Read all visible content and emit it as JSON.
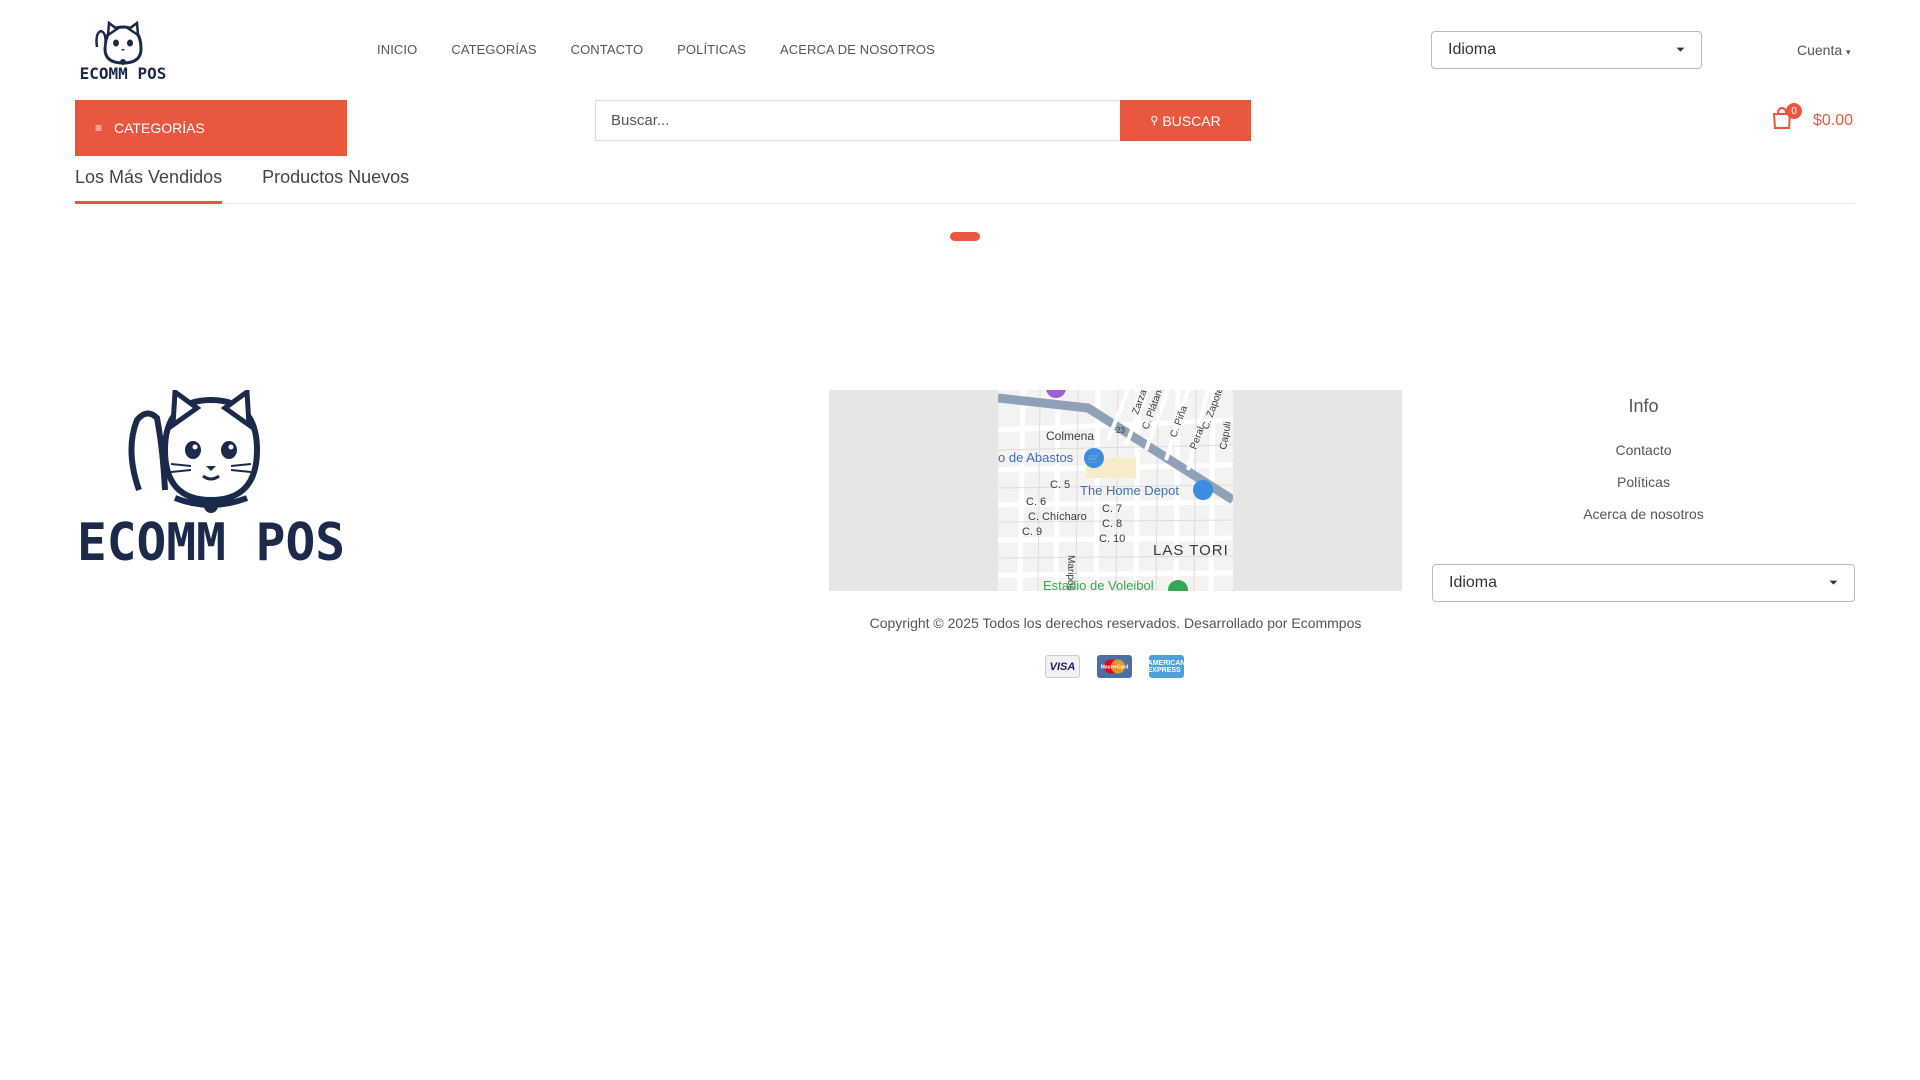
{
  "header": {
    "logo_text": "ECOMM POS",
    "nav": [
      "INICIO",
      "CATEGORÍAS",
      "CONTACTO",
      "POLÍTICAS",
      "ACERCA DE NOSOTROS"
    ],
    "language_select": {
      "selected": "Idioma"
    },
    "account_label": "Cuenta"
  },
  "toolbar": {
    "categories_label": "CATEGORÍAS",
    "search_placeholder": "Buscar...",
    "search_button": "BUSCAR",
    "cart_count": "0",
    "cart_total": "$0.00"
  },
  "product_tabs": [
    "Los Más Vendidos",
    "Productos Nuevos"
  ],
  "footer": {
    "logo_text": "ECOMM POS",
    "map_labels": [
      "Colmena",
      "o de Abastos",
      "The Home Depot",
      "C. 5",
      "C. 6",
      "C. 7",
      "C. 8",
      "C. 9",
      "C. 10",
      "C. Chícharo",
      "Mariposa",
      "LAS TORI",
      "Estadio de Voleibol",
      "C. Plátano",
      "C. Piña",
      "Peral",
      "C. Zapote",
      "Zarza",
      "Capuli",
      "23"
    ],
    "info_title": "Info",
    "info_links": [
      "Contacto",
      "Políticas",
      "Acerca de nosotros"
    ],
    "language_select": {
      "selected": "Idioma"
    },
    "copyright": "Copyright © 2025 Todos los derechos reservados. Desarrollado por Ecommpos",
    "payment_methods": [
      "VISA",
      "MasterCard",
      "AMERICAN EXPRESS"
    ]
  },
  "colors": {
    "accent": "#ea573f",
    "logo_navy": "#1b2a4a"
  }
}
